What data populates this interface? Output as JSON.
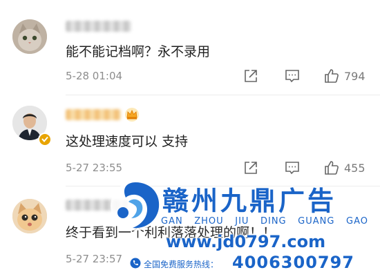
{
  "comments": [
    {
      "text": "能不能记档啊？永不录用",
      "time": "5-28 01:04",
      "likes": "794"
    },
    {
      "text": "这处理速度可以 支持",
      "time": "5-27 23:55",
      "likes": "455"
    },
    {
      "text": "终于看到一个利利落落处理的啊！！",
      "time": "5-27 23:57"
    }
  ],
  "watermark": {
    "brand": "赣州九鼎广告",
    "pinyin": [
      "GAN",
      "ZHOU",
      "JIU",
      "DING",
      "GUANG",
      "GAO"
    ],
    "url": "www.jd0797.com",
    "hotline_label": "全国免费服务热线：",
    "hotline": "4006300797"
  },
  "colors": {
    "watermark": "#1a64c8",
    "vip_badge": "#f5a623",
    "verified_badge": "#e8a400"
  },
  "icons": [
    "share-icon",
    "comment-icon",
    "like-icon",
    "crown-icon",
    "verified-icon",
    "phone-icon"
  ]
}
